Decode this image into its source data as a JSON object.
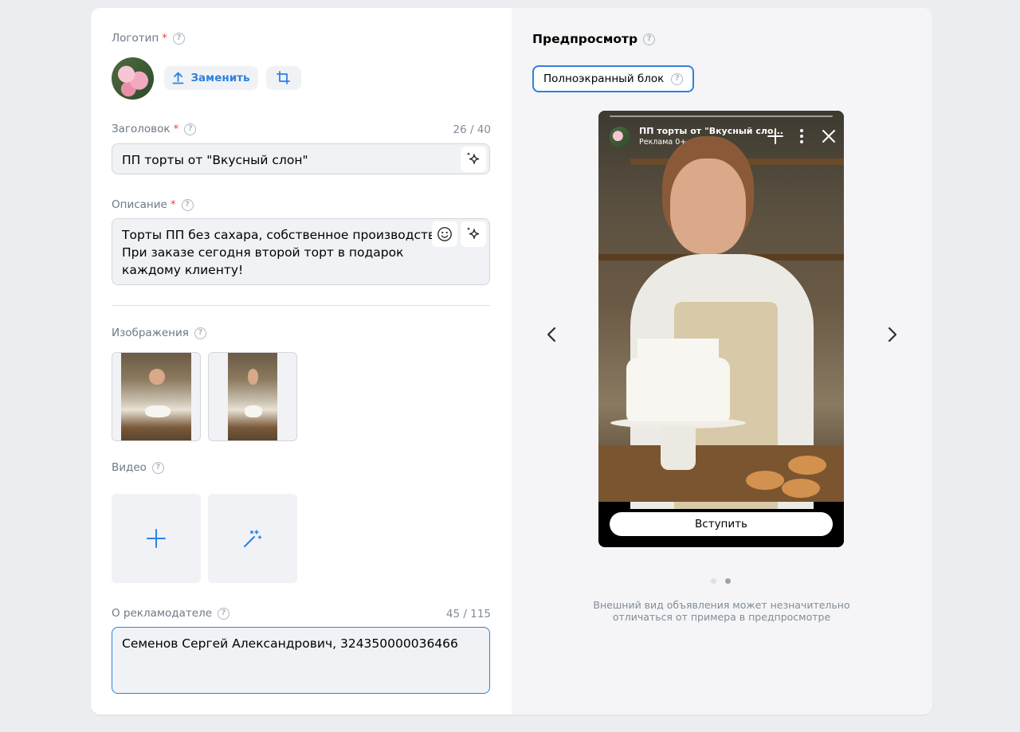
{
  "form": {
    "logo": {
      "label": "Логотип",
      "required_mark": "*",
      "replace_label": "Заменить"
    },
    "headline": {
      "label": "Заголовок",
      "required_mark": "*",
      "counter": "26 / 40",
      "value": "ПП торты от \"Вкусный слон\""
    },
    "description": {
      "label": "Описание",
      "required_mark": "*",
      "lines": [
        "Торты ПП без сахара, собственное производство.",
        "При заказе сегодня второй торт в подарок",
        "каждому клиенту!"
      ]
    },
    "images": {
      "label": "Изображения"
    },
    "video": {
      "label": "Видео"
    },
    "advertiser": {
      "label": "О рекламодателе",
      "counter": "45 / 115",
      "value": "Семенов Сергей Александрович, 324350000036466"
    }
  },
  "preview": {
    "title": "Предпросмотр",
    "format_label": "Полноэкранный блок",
    "story": {
      "title": "ПП торты от \"Вкусный сло...",
      "subtitle": "Реклама 0+",
      "cta_label": "Вступить"
    },
    "pagination": {
      "total": 2,
      "active": 2
    },
    "note_lines": [
      "Внешний вид объявления может незначительно",
      "отличаться от примера в предпросмотре"
    ]
  },
  "colors": {
    "accent": "#2d81e0",
    "required": "#e64646",
    "muted": "#818c99"
  }
}
